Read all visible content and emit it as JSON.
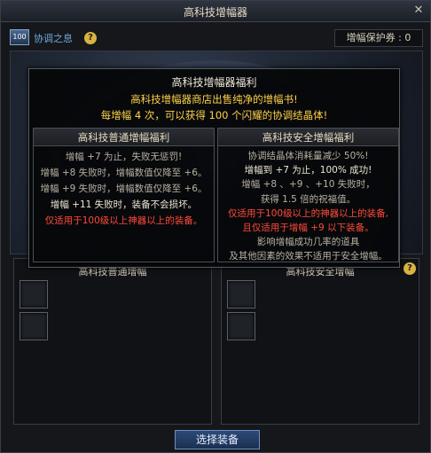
{
  "window": {
    "title": "高科技增幅器",
    "close_glyph": "✕"
  },
  "topbar": {
    "level_badge": "100",
    "harmony_label": "协调之息",
    "help_glyph": "?",
    "protection_ticket": "增幅保护券 : 0"
  },
  "panels": {
    "left_title": "高科技普通增幅",
    "right_title": "高科技安全增幅"
  },
  "tooltip": {
    "title": "高科技增幅器福利",
    "line1": "高科技增幅器商店出售纯净的增幅书!",
    "line2": "每增幅 4 次，可以获得 100 个闪耀的协调结晶体!",
    "left": {
      "header": "高科技普通增幅福利",
      "lines": [
        "增幅 +7 为止，失败无惩罚!",
        "增幅 +8 失败时，增幅数值仅降至 +6。",
        "增幅 +9 失败时，增幅数值仅降至 +6。",
        "增幅 +11 失败时，装备不会损坏。",
        "仅适用于100级以上神器以上的装备。"
      ]
    },
    "right": {
      "header": "高科技安全增幅福利",
      "lines": [
        "协调结晶体消耗量减少 50%!",
        "增幅到 +7 为止，100% 成功!",
        "增幅 +8 、+9 、+10 失败时，",
        "获得 1.5 倍的祝福值。",
        "仅适用于100级以上的神器以上的装备,",
        "且仅适用于增幅 +9 以下装备。",
        "影响增幅成功几率的道具",
        "及其他因素的效果不适用于安全增幅。"
      ]
    }
  },
  "buttons": {
    "select_equipment": "选择装备"
  }
}
